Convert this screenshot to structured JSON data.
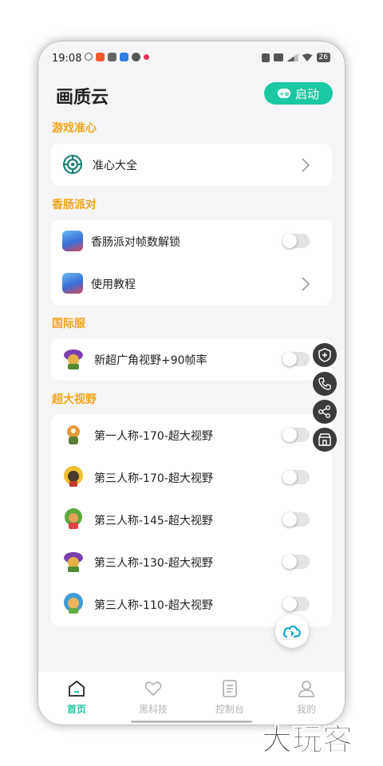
{
  "status_bar": {
    "time": "19:08",
    "battery": "26"
  },
  "header": {
    "title": "画质云",
    "launch_button": "启动",
    "launch_icon": "gamepad-icon"
  },
  "sections": [
    {
      "title": "游戏准心",
      "items": [
        {
          "label": "准心大全",
          "control": "chevron"
        }
      ]
    },
    {
      "title": "香肠派对",
      "items": [
        {
          "label": "香肠派对帧数解锁",
          "control": "toggle",
          "on": false
        },
        {
          "label": "使用教程",
          "control": "chevron"
        }
      ]
    },
    {
      "title": "国际服",
      "items": [
        {
          "label": "新超广角视野+90帧率",
          "control": "toggle",
          "on": false
        }
      ]
    },
    {
      "title": "超大视野",
      "items": [
        {
          "label": "第一人称-170-超大视野",
          "control": "toggle",
          "on": false
        },
        {
          "label": "第三人称-170-超大视野",
          "control": "toggle",
          "on": false
        },
        {
          "label": "第三人称-145-超大视野",
          "control": "toggle",
          "on": false
        },
        {
          "label": "第三人称-130-超大视野",
          "control": "toggle",
          "on": false
        },
        {
          "label": "第三人称-110-超大视野",
          "control": "toggle",
          "on": false
        }
      ]
    }
  ],
  "side_actions": [
    "shield-plus-icon",
    "phone-icon",
    "share-icon",
    "store-icon"
  ],
  "tab_bar": [
    {
      "label": "首页",
      "icon": "home-icon",
      "active": true
    },
    {
      "label": "黑科技",
      "icon": "heart-icon",
      "active": false
    },
    {
      "label": "控制台",
      "icon": "document-icon",
      "active": false
    },
    {
      "label": "我的",
      "icon": "person-icon",
      "active": false
    }
  ],
  "watermark": "大玩客",
  "colors": {
    "accent": "#1bc9a2",
    "section_title": "#f1a416",
    "background": "#f5f5f7"
  }
}
